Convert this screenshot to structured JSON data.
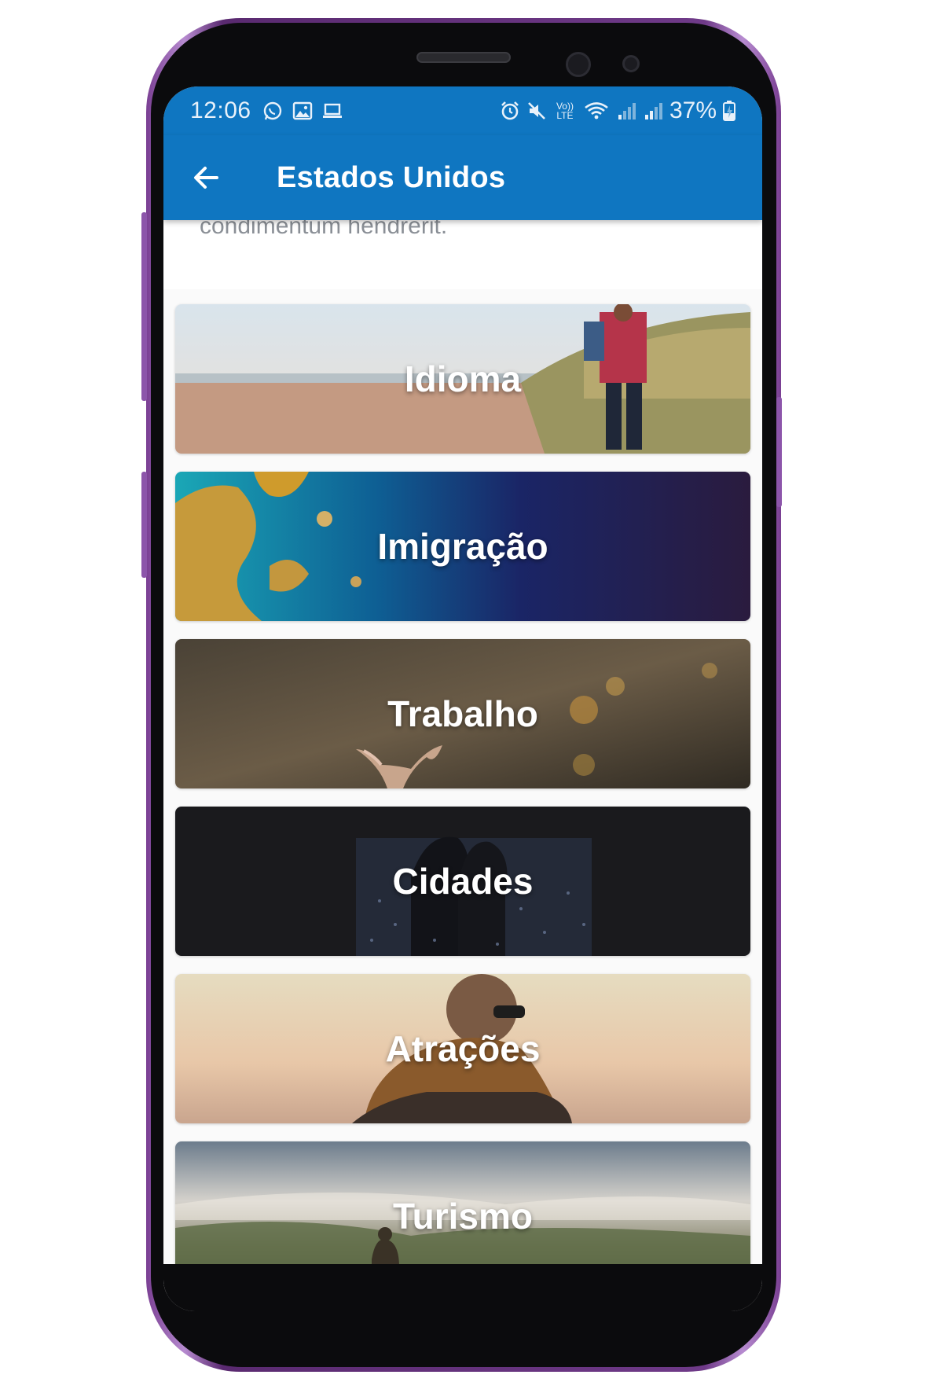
{
  "status_bar": {
    "time": "12:06",
    "battery": "37%",
    "left_icons": [
      "whatsapp-icon",
      "image-icon",
      "laptop-icon"
    ],
    "right_icons": [
      "alarm-icon",
      "mute-icon",
      "volte-icon",
      "wifi-icon",
      "signal-icon",
      "signal-roaming-icon",
      "battery-charging-icon"
    ],
    "volte_label": "Vo)) LTE"
  },
  "app_bar": {
    "title": "Estados Unidos",
    "back_icon": "arrow-left-icon",
    "color": "#0f76c1"
  },
  "intro": {
    "text": "condimentum hendrerit."
  },
  "cards": [
    {
      "label": "Idioma"
    },
    {
      "label": "Imigração"
    },
    {
      "label": "Trabalho"
    },
    {
      "label": "Cidades"
    },
    {
      "label": "Atrações"
    },
    {
      "label": "Turismo"
    }
  ]
}
